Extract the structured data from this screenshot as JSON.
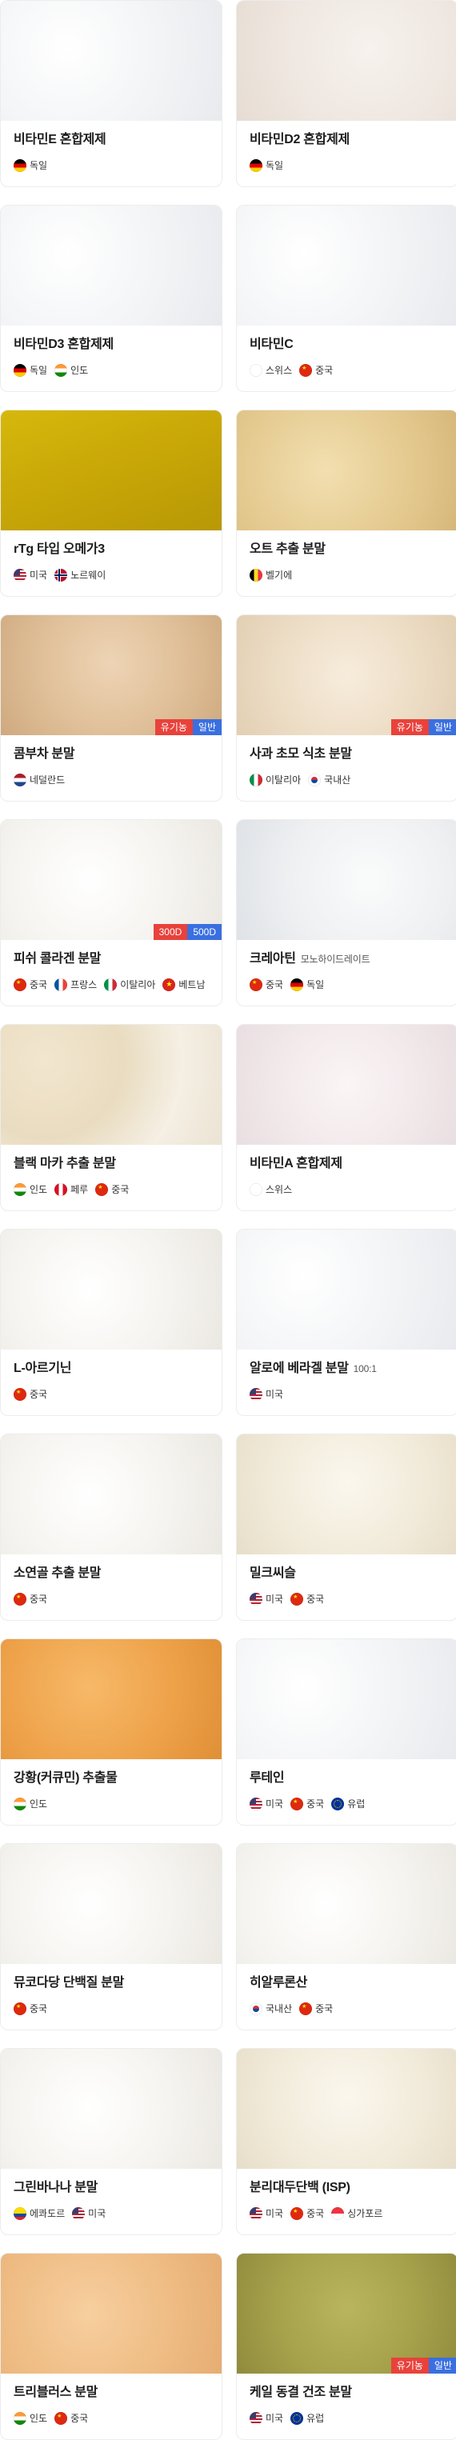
{
  "colors": {
    "badge_organic": "#e8423b",
    "badge_general": "#3a6fe0",
    "badge_300d": "#e8423b",
    "badge_500d": "#3a6fe0"
  },
  "products": [
    {
      "name": "비타민E 혼합제제",
      "sub": "",
      "origins": [
        {
          "flag": "de",
          "label": "독일"
        }
      ],
      "badges": [],
      "texture": "white-crystal"
    },
    {
      "name": "비타민D2 혼합제제",
      "sub": "",
      "origins": [
        {
          "flag": "de",
          "label": "독일"
        }
      ],
      "badges": [],
      "texture": "beige-powder"
    },
    {
      "name": "비타민D3 혼합제제",
      "sub": "",
      "origins": [
        {
          "flag": "de",
          "label": "독일"
        },
        {
          "flag": "in",
          "label": "인도"
        }
      ],
      "badges": [],
      "texture": "white-crystal"
    },
    {
      "name": "비타민C",
      "sub": "",
      "origins": [
        {
          "flag": "ch",
          "label": "스위스"
        },
        {
          "flag": "cn",
          "label": "중국"
        }
      ],
      "badges": [],
      "texture": "white-crystal"
    },
    {
      "name": "rTg 타입 오메가3",
      "sub": "",
      "origins": [
        {
          "flag": "us",
          "label": "미국"
        },
        {
          "flag": "no",
          "label": "노르웨이"
        }
      ],
      "badges": [],
      "texture": "yellow-oil"
    },
    {
      "name": "오트 추출 분말",
      "sub": "",
      "origins": [
        {
          "flag": "be",
          "label": "벨기에"
        }
      ],
      "badges": [],
      "texture": "oat-powder"
    },
    {
      "name": "콤부차 분말",
      "sub": "",
      "origins": [
        {
          "flag": "nl",
          "label": "네덜란드"
        }
      ],
      "badges": [
        {
          "label": "유기농",
          "type": "organic"
        },
        {
          "label": "일반",
          "type": "general"
        }
      ],
      "texture": "tan-powder"
    },
    {
      "name": "사과 초모 식초 분말",
      "sub": "",
      "origins": [
        {
          "flag": "it",
          "label": "이탈리아"
        },
        {
          "flag": "kr",
          "label": "국내산"
        }
      ],
      "badges": [
        {
          "label": "유기농",
          "type": "organic"
        },
        {
          "label": "일반",
          "type": "general"
        }
      ],
      "texture": "cream-powder"
    },
    {
      "name": "피쉬 콜라겐 분말",
      "sub": "",
      "origins": [
        {
          "flag": "cn",
          "label": "중국"
        },
        {
          "flag": "fr",
          "label": "프랑스"
        },
        {
          "flag": "it",
          "label": "이탈리아"
        },
        {
          "flag": "vn",
          "label": "베트남"
        }
      ],
      "badges": [
        {
          "label": "300D",
          "type": "300d"
        },
        {
          "label": "500D",
          "type": "500d"
        }
      ],
      "texture": "white-powder"
    },
    {
      "name": "크레아틴",
      "sub": "모노하이드레이트",
      "origins": [
        {
          "flag": "cn",
          "label": "중국"
        },
        {
          "flag": "de",
          "label": "독일"
        }
      ],
      "badges": [],
      "texture": "grey-white-powder"
    },
    {
      "name": "블랙 마카 추출 분말",
      "sub": "",
      "origins": [
        {
          "flag": "in",
          "label": "인도"
        },
        {
          "flag": "pe",
          "label": "페루"
        },
        {
          "flag": "cn",
          "label": "중국"
        }
      ],
      "badges": [],
      "texture": "beige-crystal"
    },
    {
      "name": "비타민A 혼합제제",
      "sub": "",
      "origins": [
        {
          "flag": "ch",
          "label": "스위스"
        }
      ],
      "badges": [],
      "texture": "pinkish-white"
    },
    {
      "name": "L-아르기닌",
      "sub": "",
      "origins": [
        {
          "flag": "cn",
          "label": "중국"
        }
      ],
      "badges": [],
      "texture": "white-powder"
    },
    {
      "name": "알로에 베라겔 분말",
      "sub": "100:1",
      "origins": [
        {
          "flag": "us",
          "label": "미국"
        }
      ],
      "badges": [],
      "texture": "white-crystal"
    },
    {
      "name": "소연골 추출 분말",
      "sub": "",
      "origins": [
        {
          "flag": "cn",
          "label": "중국"
        }
      ],
      "badges": [],
      "texture": "white-powder"
    },
    {
      "name": "밀크씨슬",
      "sub": "",
      "origins": [
        {
          "flag": "us",
          "label": "미국"
        },
        {
          "flag": "cn",
          "label": "중국"
        }
      ],
      "badges": [],
      "texture": "cream-light"
    },
    {
      "name": "강황(커큐민) 추출물",
      "sub": "",
      "origins": [
        {
          "flag": "in",
          "label": "인도"
        }
      ],
      "badges": [],
      "texture": "orange-powder"
    },
    {
      "name": "루테인",
      "sub": "",
      "origins": [
        {
          "flag": "us",
          "label": "미국"
        },
        {
          "flag": "cn",
          "label": "중국"
        },
        {
          "flag": "eu",
          "label": "유럽"
        }
      ],
      "badges": [],
      "texture": "white-crystal"
    },
    {
      "name": "뮤코다당 단백질 분말",
      "sub": "",
      "origins": [
        {
          "flag": "cn",
          "label": "중국"
        }
      ],
      "badges": [],
      "texture": "white-powder"
    },
    {
      "name": "히알루론산",
      "sub": "",
      "origins": [
        {
          "flag": "kr",
          "label": "국내산"
        },
        {
          "flag": "cn",
          "label": "중국"
        }
      ],
      "badges": [],
      "texture": "white-powder"
    },
    {
      "name": "그린바나나 분말",
      "sub": "",
      "origins": [
        {
          "flag": "ec",
          "label": "에콰도르"
        },
        {
          "flag": "us",
          "label": "미국"
        }
      ],
      "badges": [],
      "texture": "white-powder"
    },
    {
      "name": "분리대두단백 (ISP)",
      "sub": "",
      "origins": [
        {
          "flag": "us",
          "label": "미국"
        },
        {
          "flag": "cn",
          "label": "중국"
        },
        {
          "flag": "sg",
          "label": "싱가포르"
        }
      ],
      "badges": [],
      "texture": "cream-light"
    },
    {
      "name": "트리블러스 분말",
      "sub": "",
      "origins": [
        {
          "flag": "in",
          "label": "인도"
        },
        {
          "flag": "cn",
          "label": "중국"
        }
      ],
      "badges": [],
      "texture": "orange-light"
    },
    {
      "name": "케일 동결 건조 분말",
      "sub": "",
      "origins": [
        {
          "flag": "us",
          "label": "미국"
        },
        {
          "flag": "eu",
          "label": "유럽"
        }
      ],
      "badges": [
        {
          "label": "유기농",
          "type": "organic"
        },
        {
          "label": "일반",
          "type": "general"
        }
      ],
      "texture": "kale-powder"
    }
  ]
}
